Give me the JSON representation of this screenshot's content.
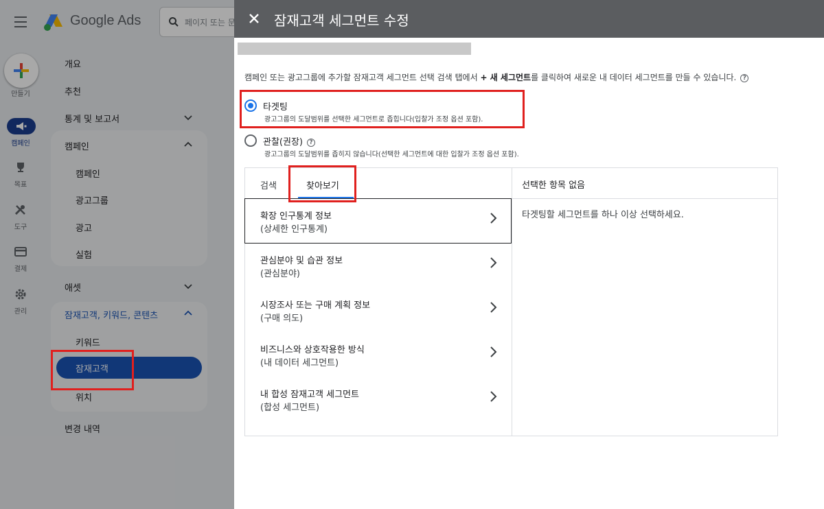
{
  "app": {
    "brand": "Google Ads",
    "search_placeholder": "페이지 또는 문"
  },
  "rail": {
    "create_label": "만들기",
    "items": [
      {
        "label": "캠페인",
        "icon": "megaphone-icon"
      },
      {
        "label": "목표",
        "icon": "trophy-icon"
      },
      {
        "label": "도구",
        "icon": "tools-icon"
      },
      {
        "label": "결제",
        "icon": "credit-card-icon"
      },
      {
        "label": "관리",
        "icon": "gear-icon"
      }
    ]
  },
  "nav": {
    "overview": "개요",
    "recommendations": "추천",
    "insights_reports": "통계 및 보고서",
    "campaigns_group": "캠페인",
    "campaigns": "캠페인",
    "ad_groups": "광고그룹",
    "ads": "광고",
    "experiments": "실험",
    "assets": "애셋",
    "audiences_group": "잠재고객, 키워드, 콘텐츠",
    "keywords": "키워드",
    "audiences": "잠재고객",
    "locations": "위치",
    "change_history": "변경 내역"
  },
  "panel": {
    "title": "잠재고객 세그먼트 수정",
    "description_pre": "캠페인 또는 광고그룹에 추가할 잠재고객 세그먼트 선택 검색 탭에서 ",
    "description_bold": "+ 새 세그먼트",
    "description_post": "를 클릭하여 새로운 내 데이터 세그먼트를 만들 수 있습니다.",
    "options": [
      {
        "label": "타겟팅",
        "sub": "광고그룹의 도달범위를 선택한 세그먼트로 좁힙니다(입찰가 조정 옵션 포함).",
        "selected": true
      },
      {
        "label": "관찰(권장)",
        "sub": "광고그룹의 도달범위를 좁히지 않습니다(선택한 세그먼트에 대한 입찰가 조정 옵션 포함).",
        "selected": false
      }
    ],
    "tabs": [
      "검색",
      "찾아보기"
    ],
    "active_tab": "찾아보기",
    "categories": [
      {
        "title": "확장 인구통계 정보",
        "sub": "(상세한 인구통계)"
      },
      {
        "title": "관심분야 및 습관 정보",
        "sub": "(관심분야)"
      },
      {
        "title": "시장조사 또는 구매 계획 정보",
        "sub": "(구매 의도)"
      },
      {
        "title": "비즈니스와 상호작용한 방식",
        "sub": "(내 데이터 세그먼트)"
      },
      {
        "title": "내 합성 잠재고객 세그먼트",
        "sub": "(합성 세그먼트)"
      }
    ],
    "selected_header": "선택한 항목 없음",
    "selected_empty": "타겟팅할 세그먼트를 하나 이상 선택하세요."
  },
  "colors": {
    "accent": "#1a73e8",
    "highlight": "#e0201e",
    "header": "#5b5d60"
  }
}
